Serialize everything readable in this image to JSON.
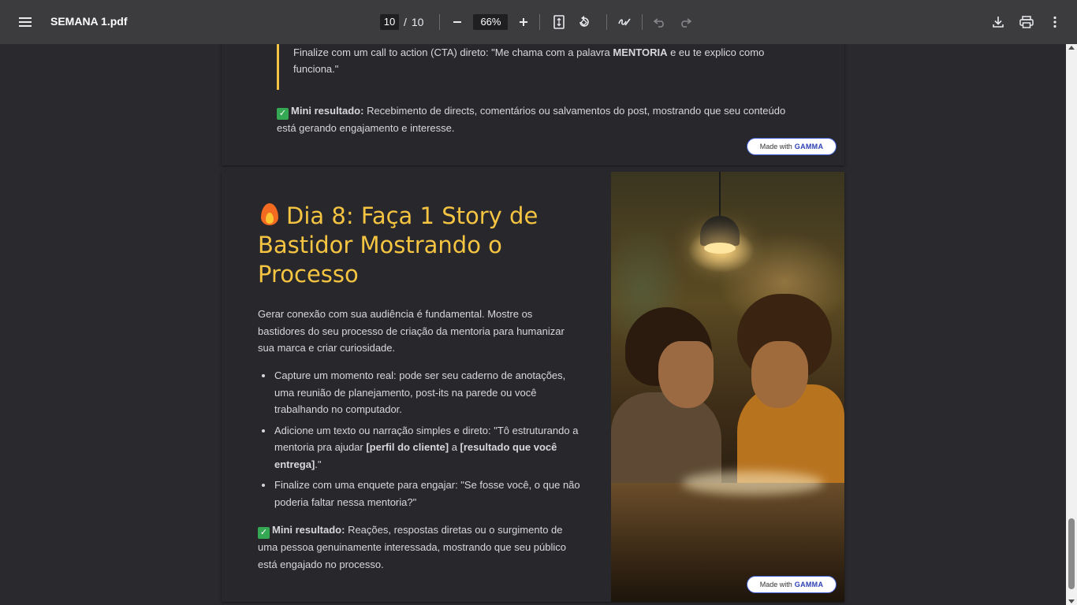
{
  "toolbar": {
    "title": "SEMANA 1.pdf",
    "page_current": "10",
    "page_separator": "/",
    "page_total": "10",
    "zoom": "66%",
    "icons": [
      "menu-icon",
      "zoom-out-icon",
      "zoom-in-icon",
      "fit-page-icon",
      "rotate-icon",
      "draw-icon",
      "undo-icon",
      "redo-icon",
      "download-icon",
      "print-icon",
      "more-icon"
    ]
  },
  "page1": {
    "quote_pre": "Finalize com um call to action (CTA) direto: \"Me chama com a palavra ",
    "quote_bold": "MENTORIA",
    "quote_post": " e eu te explico como funciona.\"",
    "result_label": "Mini resultado:",
    "result_text": " Recebimento de directs, comentários ou salvamentos do post, mostrando que seu conteúdo está gerando engajamento e interesse.",
    "badge_prefix": "Made with",
    "badge_brand": "GAMMA"
  },
  "page2": {
    "title": "Dia 8: Faça 1 Story de Bastidor Mostrando o Processo",
    "intro": "Gerar conexão com sua audiência é fundamental. Mostre os bastidores do seu processo de criação da mentoria para humanizar sua marca e criar curiosidade.",
    "bullet1": "Capture um momento real: pode ser seu caderno de anotações, uma reunião de planejamento, post-its na parede ou você trabalhando no computador.",
    "bullet2_pre": "Adicione um texto ou narração simples e direto: \"Tô estruturando a mentoria pra ajudar ",
    "bullet2_bold1": "[perfil do cliente]",
    "bullet2_mid": " a ",
    "bullet2_bold2": "[resultado que você entrega]",
    "bullet2_post": ".\"",
    "bullet3": "Finalize com uma enquete para engajar: \"Se fosse você, o que não poderia faltar nessa mentoria?\"",
    "result_label": "Mini resultado:",
    "result_text": " Reações, respostas diretas ou o surgimento de uma pessoa genuinamente interessada, mostrando que seu público está engajado no processo.",
    "badge_prefix": "Made with",
    "badge_brand": "GAMMA"
  },
  "colors": {
    "toolbar": "#3c3c3f",
    "viewer": "#2a2a2e",
    "page": "#28272c",
    "accent": "#f5c542"
  }
}
